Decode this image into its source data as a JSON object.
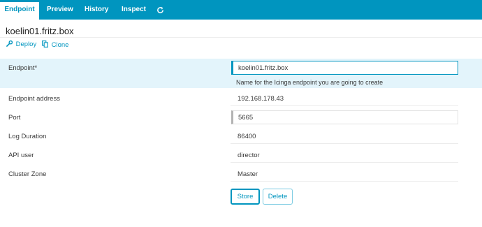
{
  "tabs": [
    {
      "label": "Endpoint"
    },
    {
      "label": "Preview"
    },
    {
      "label": "History"
    },
    {
      "label": "Inspect"
    }
  ],
  "refresh_icon": "refresh-icon",
  "page_title": "koelin01.fritz.box",
  "actions": {
    "deploy": {
      "label": "Deploy",
      "icon": "wrench-icon"
    },
    "clone": {
      "label": "Clone",
      "icon": "copy-icon"
    }
  },
  "form": {
    "endpoint": {
      "label": "Endpoint*",
      "value": "koelin01.fritz.box",
      "hint": "Name for the Icinga endpoint you are going to create"
    },
    "endpoint_address": {
      "label": "Endpoint address",
      "value": "192.168.178.43"
    },
    "port": {
      "label": "Port",
      "value": "5665"
    },
    "log_duration": {
      "label": "Log Duration",
      "value": "86400"
    },
    "api_user": {
      "label": "API user",
      "value": "director"
    },
    "cluster_zone": {
      "label": "Cluster Zone",
      "value": "Master"
    }
  },
  "buttons": {
    "store": "Store",
    "delete": "Delete"
  },
  "colors": {
    "accent": "#0095bf",
    "highlight_row": "#e3f4fb"
  }
}
